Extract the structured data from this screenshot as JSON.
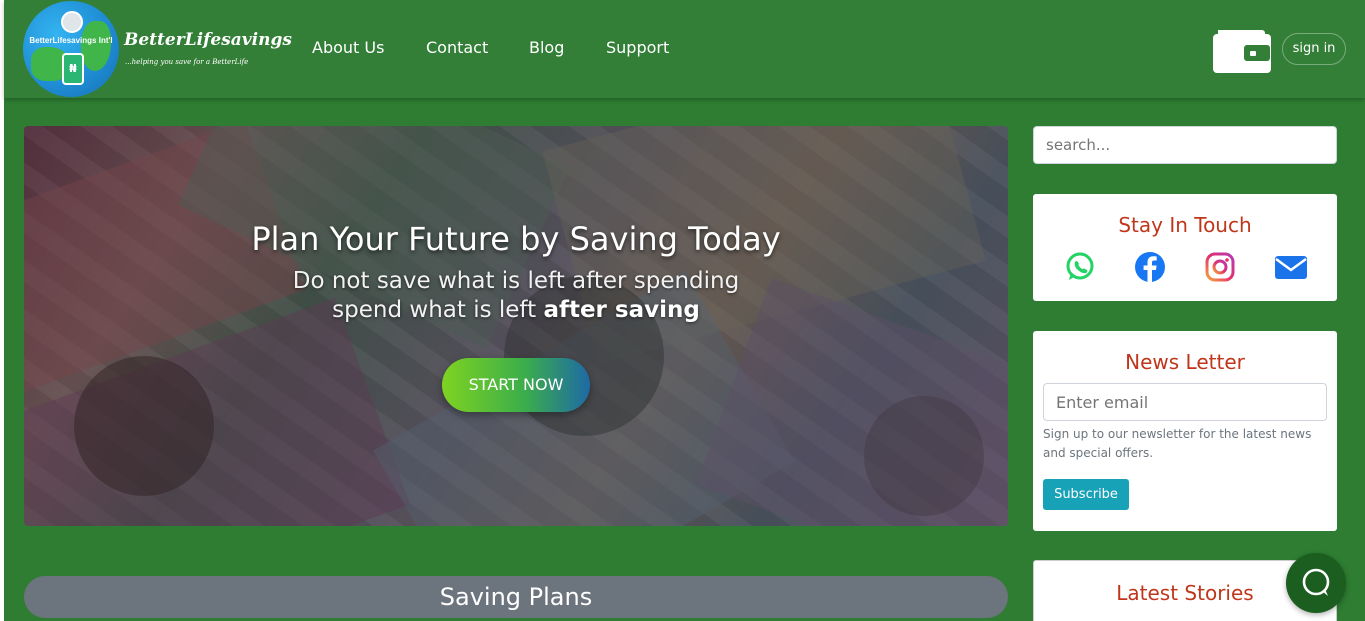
{
  "header": {
    "logo_text": "BetterLifesavings Int'l",
    "brand_name": "BetterLifesavings",
    "brand_tagline": "...helping you save for a BetterLife",
    "nav": [
      {
        "label": "About Us"
      },
      {
        "label": "Contact"
      },
      {
        "label": "Blog"
      },
      {
        "label": "Support"
      }
    ],
    "wallet_icon": "wallet-icon",
    "signin_label": "sign in"
  },
  "hero": {
    "title": "Plan Your Future by Saving Today",
    "subtitle_line1": "Do not save what is left after spending",
    "subtitle_line2_prefix": "spend what is left",
    "subtitle_line2_bold": "after saving",
    "cta_label": "START NOW"
  },
  "saving_plans": {
    "title": "Saving Plans"
  },
  "sidebar": {
    "search_placeholder": "search...",
    "stay_in_touch": {
      "title": "Stay In Touch",
      "icons": [
        "whatsapp-icon",
        "facebook-icon",
        "instagram-icon",
        "envelope-icon"
      ]
    },
    "newsletter": {
      "title": "News Letter",
      "email_placeholder": "Enter email",
      "note": "Sign up to our newsletter for the latest news and special offers.",
      "subscribe_label": "Subscribe"
    },
    "latest_stories": {
      "title": "Latest Stories"
    }
  },
  "colors": {
    "header_green": "#337f37",
    "page_green": "#2e7d32",
    "accent_red": "#c0361b",
    "subscribe_teal": "#17a2b8",
    "pill_gray": "#6c757d"
  }
}
